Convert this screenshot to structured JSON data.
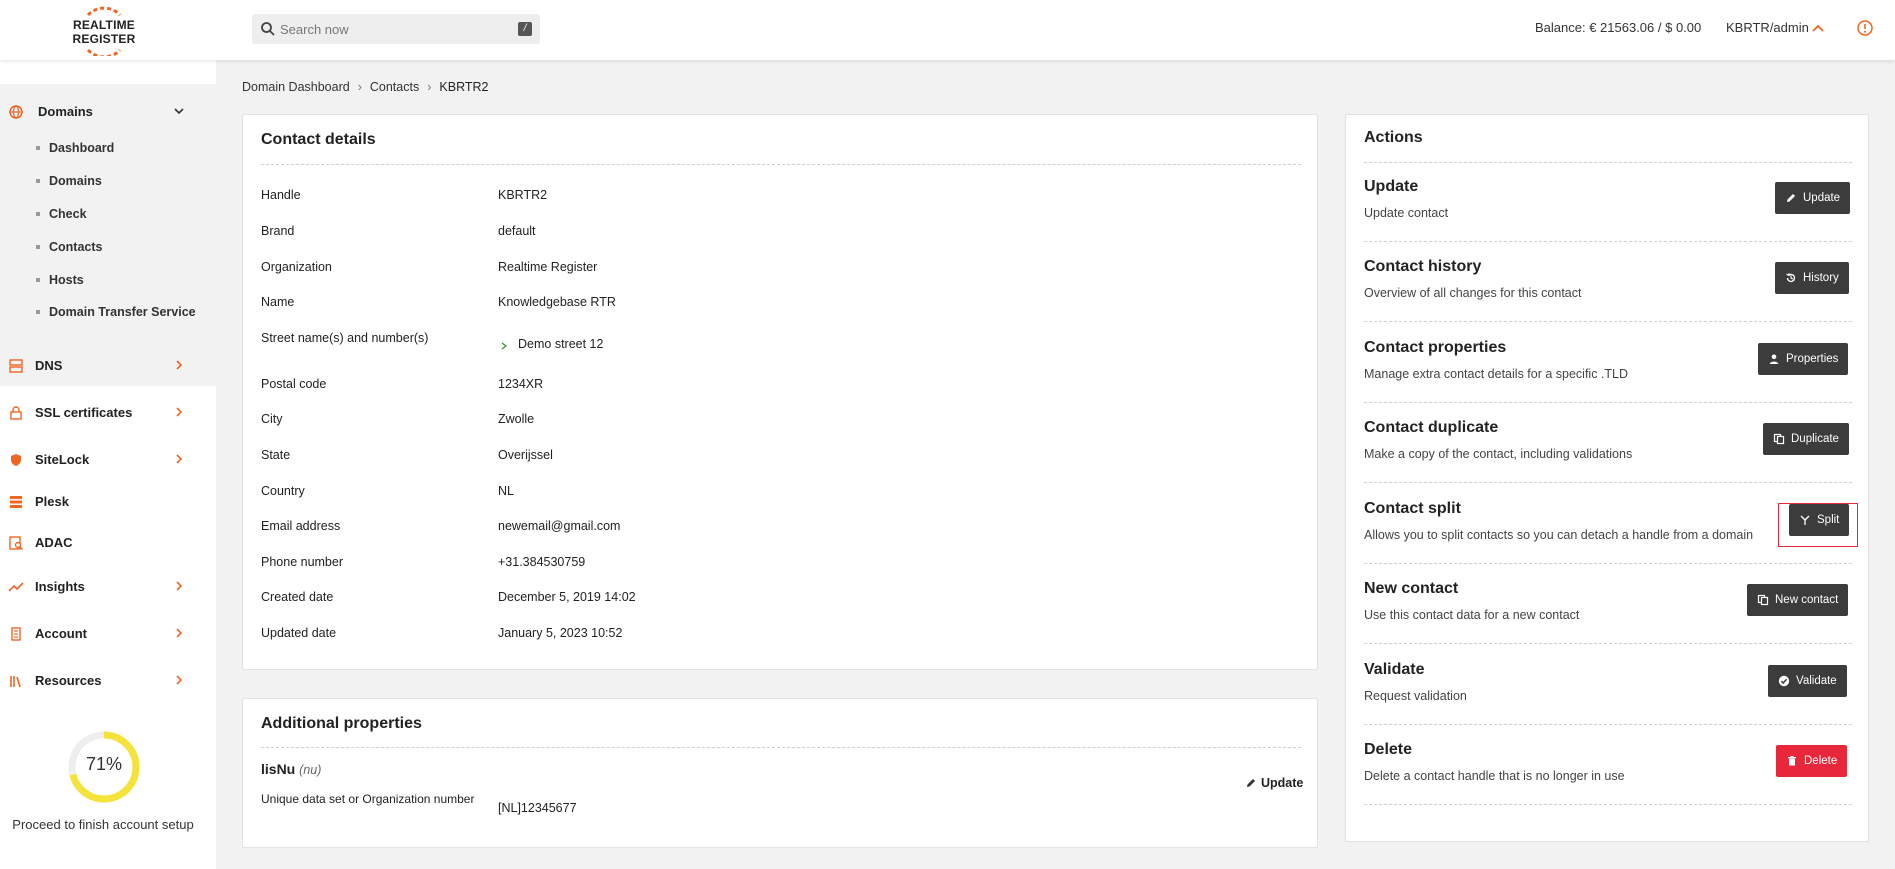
{
  "header": {
    "logo_line1": "REALTIME",
    "logo_line2": "REGISTER",
    "search_placeholder": "Search now",
    "search_shortcut": "/",
    "balance": "Balance: € 21563.06 / $ 0.00",
    "user": "KBRTR/admin"
  },
  "sidebar": {
    "sections": [
      {
        "label": "Domains",
        "icon": "globe-icon"
      },
      {
        "label": "DNS",
        "icon": "server-icon"
      },
      {
        "label": "SSL certificates",
        "icon": "lock-icon"
      },
      {
        "label": "SiteLock",
        "icon": "shield-icon"
      },
      {
        "label": "Plesk",
        "icon": "stack-icon"
      },
      {
        "label": "ADAC",
        "icon": "search-doc-icon"
      },
      {
        "label": "Insights",
        "icon": "chart-line-icon"
      },
      {
        "label": "Account",
        "icon": "building-icon"
      },
      {
        "label": "Resources",
        "icon": "books-icon"
      }
    ],
    "domain_items": [
      "Dashboard",
      "Domains",
      "Check",
      "Contacts",
      "Hosts",
      "Domain Transfer Service"
    ],
    "progress_label": "71%",
    "progress_value": 0.71,
    "setup_text": "Proceed to finish account setup"
  },
  "breadcrumb": [
    "Domain Dashboard",
    "Contacts",
    "KBRTR2"
  ],
  "contact": {
    "title": "Contact details",
    "rows": [
      {
        "label": "Handle",
        "value": "KBRTR2"
      },
      {
        "label": "Brand",
        "value": "default"
      },
      {
        "label": "Organization",
        "value": "Realtime Register"
      },
      {
        "label": "Name",
        "value": "Knowledgebase RTR"
      },
      {
        "label": "Street name(s) and number(s)",
        "value": "Demo street 12"
      },
      {
        "label": "Postal code",
        "value": "1234XR"
      },
      {
        "label": "City",
        "value": "Zwolle"
      },
      {
        "label": "State",
        "value": "Overijssel"
      },
      {
        "label": "Country",
        "value": "NL"
      },
      {
        "label": "Email address",
        "value": "newemail@gmail.com"
      },
      {
        "label": "Phone number",
        "value": "+31.384530759"
      },
      {
        "label": "Created date",
        "value": "December 5, 2019 14:02"
      },
      {
        "label": "Updated date",
        "value": "January 5, 2023 10:52"
      }
    ]
  },
  "additional": {
    "title": "Additional properties",
    "prop_name": "lisNu",
    "prop_tld": "(nu)",
    "prop_desc": "Unique data set or Organization number",
    "prop_value": "[NL]12345677",
    "update_label": "Update"
  },
  "actions": {
    "title": "Actions",
    "items": [
      {
        "title": "Update",
        "desc": "Update contact",
        "button": "Update",
        "icon": "pencil-icon"
      },
      {
        "title": "Contact history",
        "desc": "Overview of all changes for this contact",
        "button": "History",
        "icon": "history-icon"
      },
      {
        "title": "Contact properties",
        "desc": "Manage extra contact details for a specific .TLD",
        "button": "Properties",
        "icon": "person-icon"
      },
      {
        "title": "Contact duplicate",
        "desc": "Make a copy of the contact, including validations",
        "button": "Duplicate",
        "icon": "copy-icon"
      },
      {
        "title": "Contact split",
        "desc": "Allows you to split contacts so you can detach a handle from a domain",
        "button": "Split",
        "icon": "split-icon"
      },
      {
        "title": "New contact",
        "desc": "Use this contact data for a new contact",
        "button": "New contact",
        "icon": "copy-icon"
      },
      {
        "title": "Validate",
        "desc": "Request validation",
        "button": "Validate",
        "icon": "check-circle-icon"
      },
      {
        "title": "Delete",
        "desc": "Delete a contact handle that is no longer in use",
        "button": "Delete",
        "icon": "trash-icon"
      }
    ]
  },
  "colors": {
    "accent": "#f26522",
    "danger": "#e8283a",
    "button_dark": "#3c3c3c",
    "progress": "#f5e23a"
  }
}
